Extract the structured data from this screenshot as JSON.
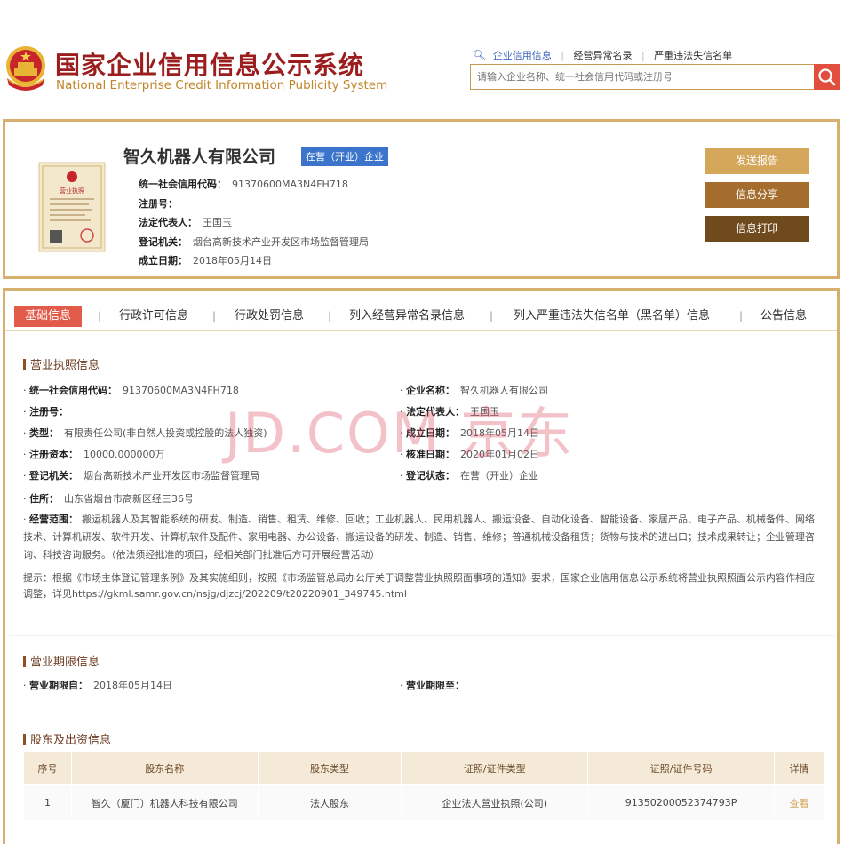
{
  "header": {
    "title_cn": "国家企业信用信息公示系统",
    "title_en": "National Enterprise Credit Information Publicity System",
    "search_links": [
      "企业信用信息",
      "经营异常名录",
      "严重违法失信名单"
    ],
    "search_placeholder": "请输入企业名称、统一社会信用代码或注册号"
  },
  "company": {
    "name": "智久机器人有限公司",
    "status": "在营（开业）企业",
    "fields": [
      {
        "label": "统一社会信用代码：",
        "value": "91370600MA3N4FH718"
      },
      {
        "label": "注册号：",
        "value": ""
      },
      {
        "label": "法定代表人：",
        "value": "王国玉"
      },
      {
        "label": "登记机关：",
        "value": "烟台高新技术产业开发区市场监督管理局"
      },
      {
        "label": "成立日期：",
        "value": "2018年05月14日"
      }
    ],
    "license_label": "营业执照",
    "actions": {
      "report": "发送报告",
      "share": "信息分享",
      "print": "信息打印"
    }
  },
  "tabs": [
    "基础信息",
    "行政许可信息",
    "行政处罚信息",
    "列入经营异常名录信息",
    "列入严重违法失信名单（黑名单）信息",
    "公告信息"
  ],
  "license_info": {
    "title": "营业执照信息",
    "left": [
      {
        "label": "统一社会信用代码：",
        "value": "91370600MA3N4FH718"
      },
      {
        "label": "注册号：",
        "value": ""
      },
      {
        "label": "类型：",
        "value": "有限责任公司(非自然人投资或控股的法人独资)"
      },
      {
        "label": "注册资本：",
        "value": "10000.000000万"
      },
      {
        "label": "登记机关：",
        "value": "烟台高新技术产业开发区市场监督管理局"
      },
      {
        "label": "住所：",
        "value": "山东省烟台市高新区经三36号"
      }
    ],
    "right": [
      {
        "label": "企业名称：",
        "value": "智久机器人有限公司"
      },
      {
        "label": "法定代表人：",
        "value": "王国玉"
      },
      {
        "label": "成立日期：",
        "value": "2018年05月14日"
      },
      {
        "label": "核准日期：",
        "value": "2020年01月02日"
      },
      {
        "label": "登记状态：",
        "value": "在营（开业）企业"
      }
    ],
    "scope_label": "经营范围：",
    "scope_value": "搬运机器人及其智能系统的研发、制造、销售、租赁、维修、回收；工业机器人、民用机器人、搬运设备、自动化设备、智能设备、家居产品、电子产品、机械备件、网络技术、计算机研发、软件开发、计算机软件及配件、家用电器、办公设备、搬运设备的研发、制造、销售、维修；普通机械设备租赁；货物与技术的进出口；技术成果转让；企业管理咨询、科技咨询服务。（依法须经批准的项目，经相关部门批准后方可开展经营活动）",
    "tip": "提示：根据《市场主体登记管理条例》及其实施细则，按照《市场监管总局办公厅关于调整营业执照照面事项的通知》要求，国家企业信用信息公示系统将营业执照照面公示内容作相应调整，详见https://gkml.samr.gov.cn/nsjg/djzcj/202209/t20220901_349745.html"
  },
  "term_info": {
    "title": "营业期限信息",
    "from_label": "营业期限自：",
    "from_value": "2018年05月14日",
    "to_label": "营业期限至：",
    "to_value": ""
  },
  "shareholders": {
    "title": "股东及出资信息",
    "columns": [
      "序号",
      "股东名称",
      "股东类型",
      "证照/证件类型",
      "证照/证件号码",
      "详情"
    ],
    "rows": [
      [
        "1",
        "智久（厦门）机器人科技有限公司",
        "法人股东",
        "企业法人营业执照(公司)",
        "91350200052374793P",
        "查看"
      ]
    ]
  },
  "watermark": "JD.COM 京东",
  "colors": {
    "brand_red": "#9b1d1d",
    "gold": "#d6b06f",
    "badge_blue": "#3c74cc",
    "tab_active": "#e25a4a"
  }
}
